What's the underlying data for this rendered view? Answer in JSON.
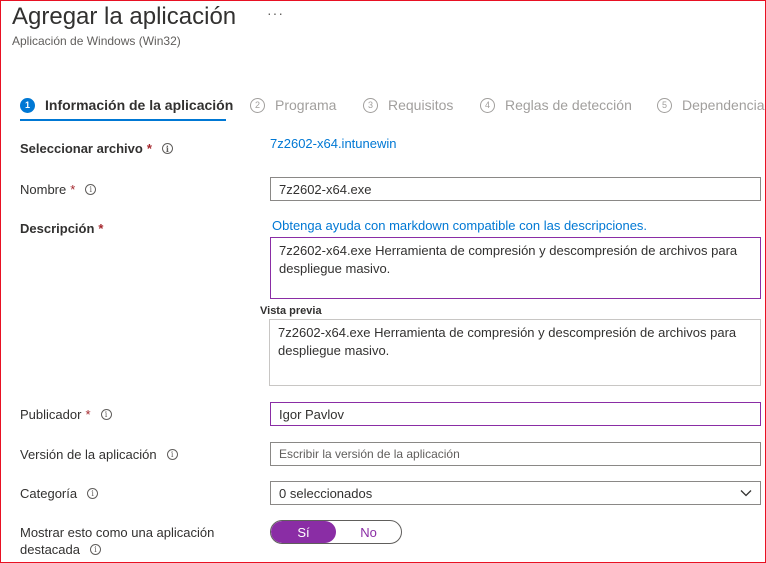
{
  "header": {
    "title": "Agregar la aplicación",
    "more": "···",
    "subtitle": "Aplicación de Windows (Win32)"
  },
  "steps": [
    {
      "num": "1",
      "label": "Información de la aplicación"
    },
    {
      "num": "2",
      "label": "Programa"
    },
    {
      "num": "3",
      "label": "Requisitos"
    },
    {
      "num": "4",
      "label": "Reglas de detección"
    },
    {
      "num": "5",
      "label": "Dependencia"
    }
  ],
  "form": {
    "file": {
      "label": "Seleccionar archivo",
      "required": "*",
      "value": "7z2602-x64.intunewin"
    },
    "name": {
      "label": "Nombre",
      "required": "*",
      "value": "7z2602-x64.exe"
    },
    "description": {
      "label": "Descripción",
      "required": "*",
      "help_link": "Obtenga ayuda con markdown compatible con las descripciones.",
      "value": "7z2602-x64.exe Herramienta de compresión y descompresión de archivos para despliegue masivo.",
      "preview_label": "Vista previa",
      "preview_text": "7z2602-x64.exe Herramienta de compresión y descompresión de archivos para despliegue masivo."
    },
    "publisher": {
      "label": "Publicador",
      "required": "*",
      "value": "Igor Pavlov"
    },
    "version": {
      "label": "Versión de la aplicación",
      "placeholder": "Escribir la versión de la aplicación"
    },
    "category": {
      "label": "Categoría",
      "value": "0 seleccionados"
    },
    "featured": {
      "label_line1": "Mostrar esto como una aplicación",
      "label_line2": "destacada",
      "on": "Sí",
      "off": "No"
    }
  },
  "info_glyph": "i",
  "colors": {
    "accent": "#0078d4",
    "toggle": "#8a2da5",
    "required": "#a4262c",
    "frame": "#e81123"
  }
}
